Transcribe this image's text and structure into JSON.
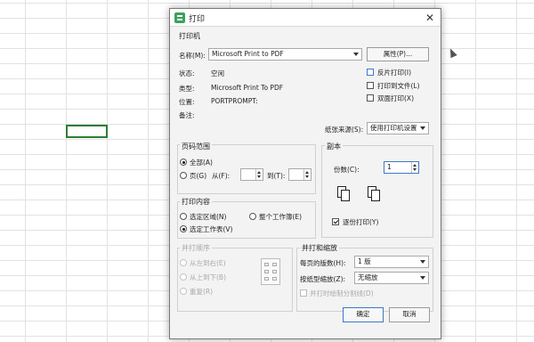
{
  "dialog": {
    "title": "打印",
    "close_glyph": "✕"
  },
  "printer": {
    "section": "打印机",
    "name_label": "名称(M):",
    "name_value": "Microsoft Print to PDF",
    "properties_button": "属性(P)...",
    "status_label": "状态:",
    "status_value": "空闲",
    "type_label": "类型:",
    "type_value": "Microsoft Print To PDF",
    "location_label": "位置:",
    "location_value": "PORTPROMPT:",
    "comment_label": "备注:",
    "reverse_print": "反片打印(I)",
    "print_to_file": "打印到文件(L)",
    "duplex": "双面打印(X)",
    "paper_source_label": "纸张来源(S):",
    "paper_source_value": "使用打印机设置"
  },
  "page_range": {
    "section": "页码范围",
    "all": "全部(A)",
    "pages": "页(G)",
    "from": "从(F):",
    "to": "到(T):"
  },
  "print_content": {
    "section": "打印内容",
    "selection": "选定区域(N)",
    "entire_workbook": "整个工作簿(E)",
    "selected_sheets": "选定工作表(V)"
  },
  "copies": {
    "section": "副本",
    "count_label": "份数(C):",
    "count_value": "1",
    "collate": "逐份打印(Y)"
  },
  "order": {
    "section": "并打顺序",
    "left_to_right": "从左到右(E)",
    "top_to_bottom": "从上到下(B)",
    "repeat": "重复(R)"
  },
  "scale": {
    "section": "并打和缩放",
    "pages_per_sheet_label": "每页的版数(H):",
    "pages_per_sheet_value": "1 版",
    "scale_to_paper_label": "按纸型缩放(Z):",
    "scale_to_paper_value": "无缩放",
    "draw_borders": "并打时绘制分割线(D)"
  },
  "buttons": {
    "ok": "确定",
    "cancel": "取消"
  },
  "colors": {
    "accent": "#3b78c9",
    "active_cell": "#2e7d32",
    "app_icon": "#3aa35b"
  }
}
